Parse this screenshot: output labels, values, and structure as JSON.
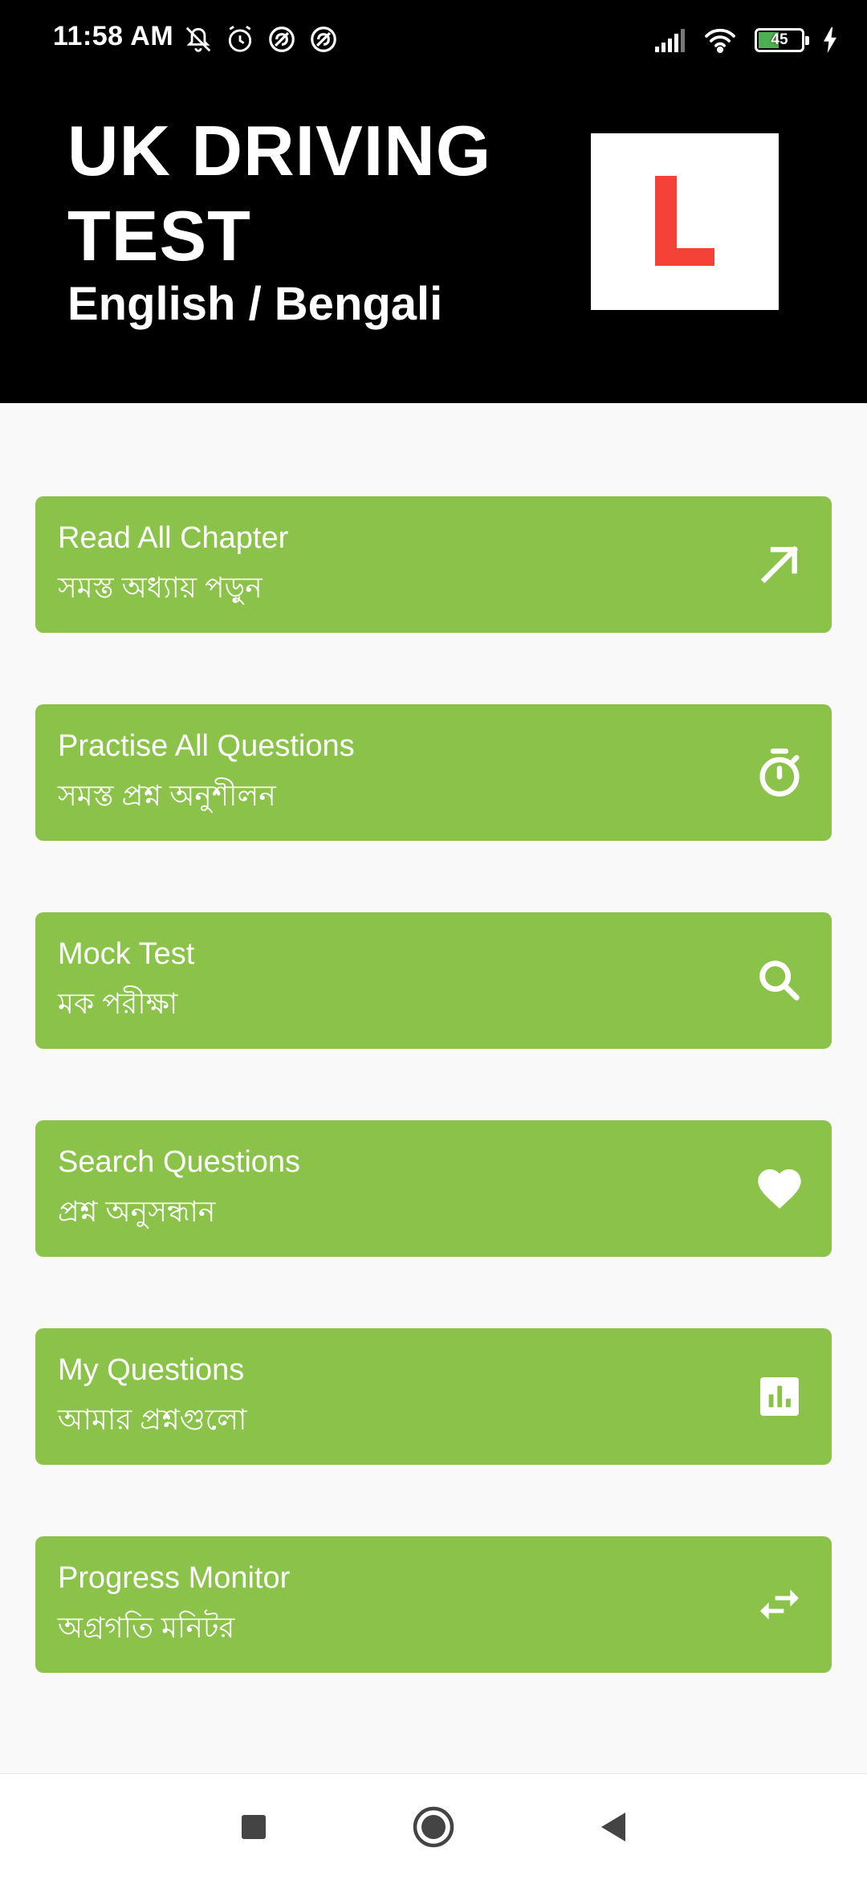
{
  "status_bar": {
    "time": "11:58 AM",
    "battery_level": "45",
    "left_icons": [
      "mute-icon",
      "alarm-icon",
      "notification-icon",
      "notification-icon"
    ],
    "right_icons": [
      "signal-icon",
      "wifi-icon",
      "battery-icon",
      "charging-icon"
    ]
  },
  "header": {
    "title_line1": "UK DRIVING",
    "title_line2": "TEST",
    "subtitle": "English / Bengali",
    "logo_letter": "L",
    "logo_color": "#f44336",
    "background": "#000000"
  },
  "menu": {
    "accent": "#8bc34a",
    "items": [
      {
        "title": "Read All Chapter",
        "subtitle": "সমস্ত অধ্যায় পড়ুন",
        "icon": "arrow-up-right-icon"
      },
      {
        "title": "Practise All Questions",
        "subtitle": "সমস্ত প্রশ্ন অনুশীলন",
        "icon": "timer-icon"
      },
      {
        "title": "Mock Test",
        "subtitle": "মক পরীক্ষা",
        "icon": "search-icon"
      },
      {
        "title": "Search Questions",
        "subtitle": "প্রশ্ন অনুসন্ধান",
        "icon": "heart-icon"
      },
      {
        "title": "My Questions",
        "subtitle": "আমার প্রশ্নগুলো",
        "icon": "bar-chart-icon"
      },
      {
        "title": "Progress Monitor",
        "subtitle": "অগ্রগতি মনিটর",
        "icon": "swap-arrows-icon"
      }
    ]
  },
  "nav_bar": {
    "buttons": [
      "recents-icon",
      "home-icon",
      "back-icon"
    ]
  }
}
